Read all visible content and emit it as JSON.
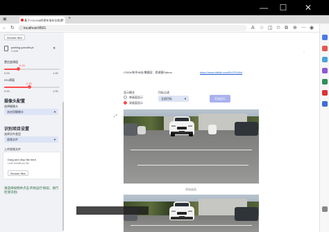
{
  "window": {
    "minimize_glyph": "—",
    "maximize_glyph": "☐",
    "close_glyph": "✕"
  },
  "browser": {
    "tab_title": "基于YOLOv8的停车场车位检测",
    "tab_close_glyph": "✕",
    "new_tab_glyph": "+",
    "address": "localhost:8501",
    "icons": [
      "back-icon",
      "forward-icon",
      "refresh-icon",
      "info-icon",
      "star-icon",
      "collections-icon",
      "more-icon"
    ]
  },
  "sidebar": {
    "browse_label": "Browse files",
    "file_name": "parking.yolov8n.pt",
    "file_size": "6.2MB",
    "file_close_glyph": "✕",
    "conf": {
      "label": "置信度阈值",
      "value": "0.25",
      "min": "0.00",
      "max": "1.00",
      "fraction": 0.25
    },
    "iou": {
      "label": "IOU阈值",
      "value": "0.45",
      "min": "0.00",
      "max": "1.00",
      "fraction": 0.45
    },
    "camera_header": "摄像头配置",
    "camera_select_label": "选择摄像头",
    "camera_select_value": "未启用摄像头",
    "task_header": "识别项目设置",
    "file_type_label": "选择文件类型",
    "file_type_value": "视频文件",
    "upload_label": "上传视频文件",
    "drop_text": "Drag and drop file here",
    "drop_limit": "Limit 200MB per file",
    "browse_label2": "Browse files",
    "hint": "请选择视频并点击'开始运行'按钮，进行检测识别!"
  },
  "main": {
    "author_line": "CSDN/知乎/B站/博客园：思源客Python",
    "link_text": "https://www.bilibili.com/BV1FK4N4",
    "display_mode_label": "显示模式",
    "display_modes": [
      "单画面显示",
      "双画面显示"
    ],
    "display_mode_selected": 1,
    "save_label": "目标过滤",
    "save_value": "全部目标",
    "run_button": "开始运行",
    "caption": "原始画面"
  },
  "colors": {
    "accent": "#ff4b4b",
    "sidebar_bg": "#f0f2f6",
    "select_bg": "#dde4f5",
    "run_button": "#a9b1ee",
    "link": "#1a5fd1"
  }
}
